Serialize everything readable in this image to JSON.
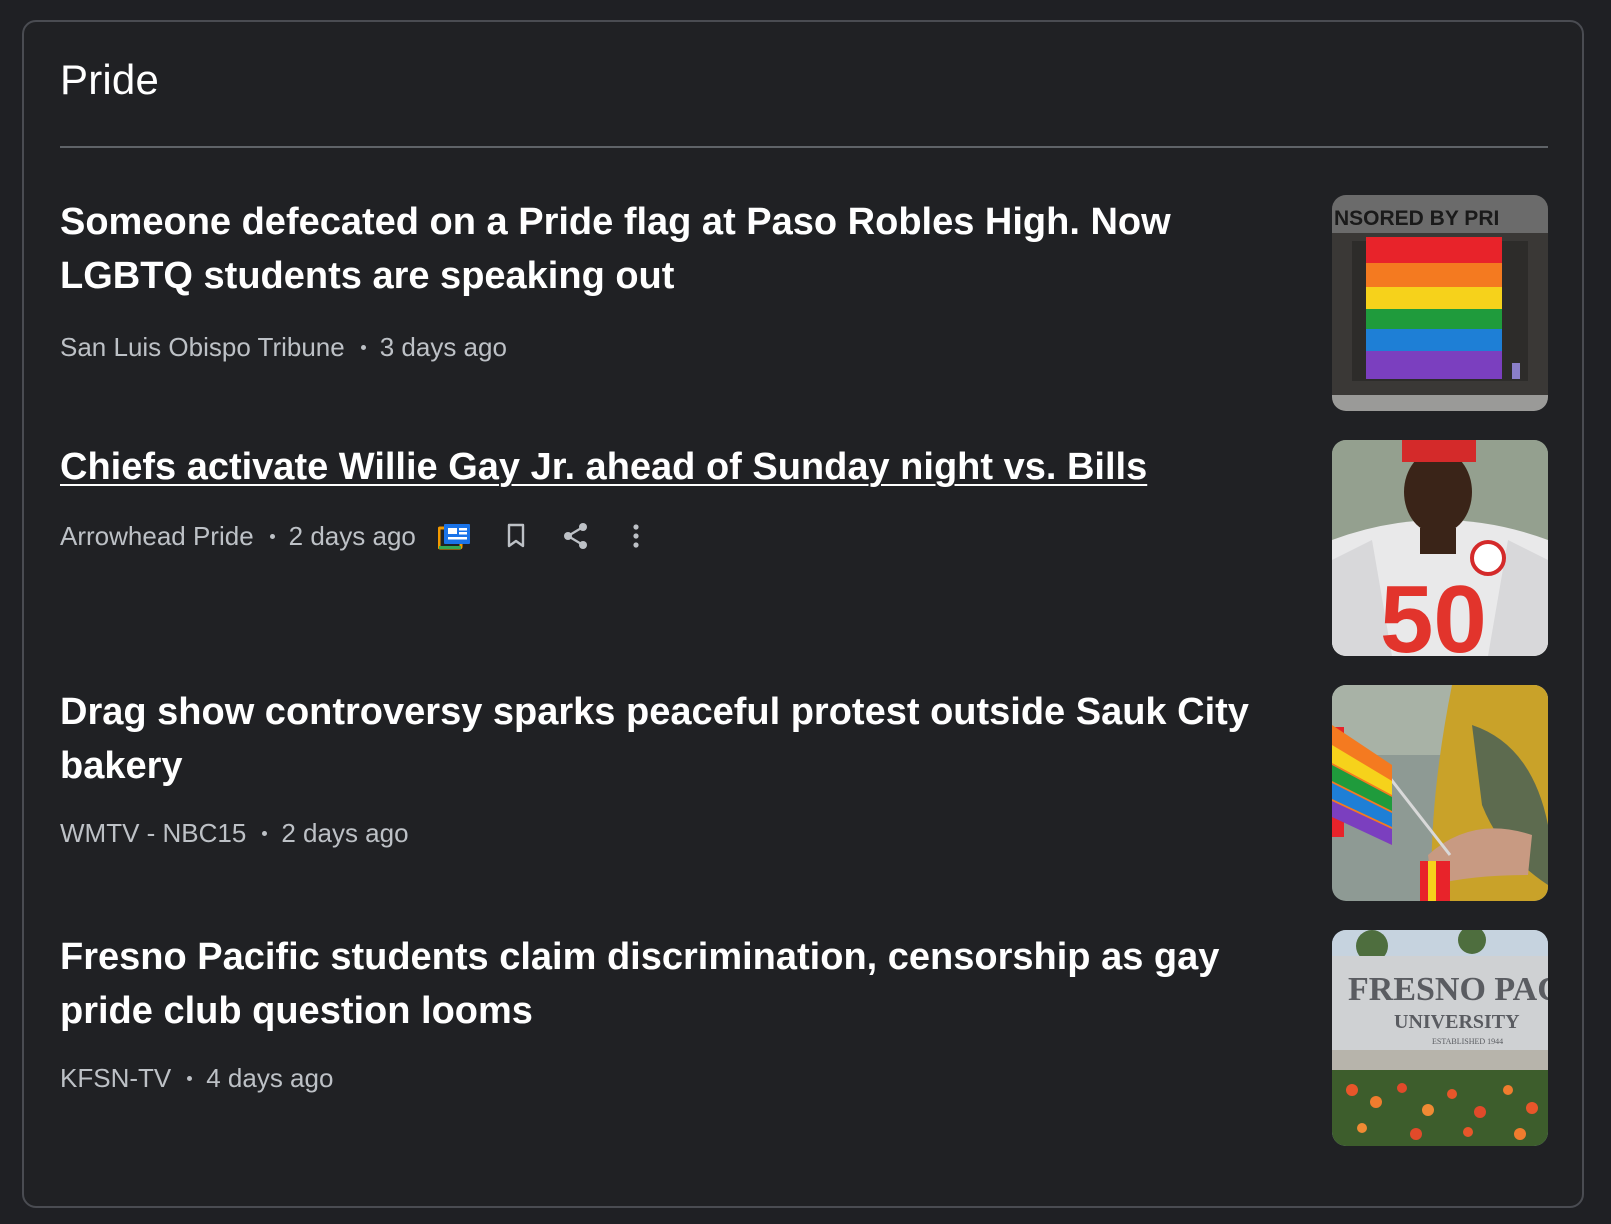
{
  "section": {
    "title": "Pride"
  },
  "articles": [
    {
      "headline": "Someone defecated on a Pride flag at Paso Robles High. Now LGBTQ students are speaking out",
      "source": "San Luis Obispo Tribune",
      "age": "3 days ago",
      "thumbnail_text": "NSORED   BY   PRI"
    },
    {
      "headline": "Chiefs activate Willie Gay Jr. ahead of Sunday night vs. Bills",
      "source": "Arrowhead Pride",
      "age": "2 days ago",
      "thumbnail_text": "50",
      "actions": [
        "full-coverage-icon",
        "bookmark-icon",
        "share-icon",
        "more-vert-icon"
      ]
    },
    {
      "headline": "Drag show controversy sparks peaceful protest outside Sauk City bakery",
      "source": "WMTV - NBC15",
      "age": "2 days ago"
    },
    {
      "headline": "Fresno Pacific students claim discrimination, censorship as gay pride club question looms",
      "source": "KFSN-TV",
      "age": "4 days ago",
      "thumbnail_text_1": "FRESNO PACIFIC",
      "thumbnail_text_2": "UNIVERSITY",
      "thumbnail_text_3": "ESTABLISHED 1944"
    }
  ],
  "colors": {
    "background": "#202124",
    "border": "#4a4c52",
    "headline": "#ffffff",
    "meta": "#bdc1c6",
    "divider": "#5f6368"
  }
}
